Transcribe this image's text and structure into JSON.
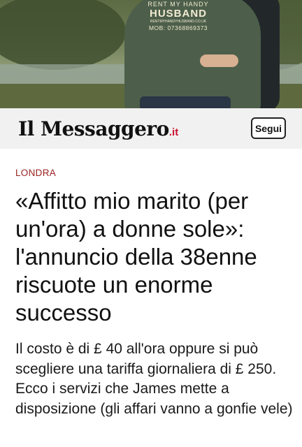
{
  "hero": {
    "shirt_line1": "RENT MY HANDY",
    "shirt_line2": "HUSBAND",
    "shirt_line3": "RENTMYHANDYHUSBAND.CO.UK",
    "shirt_line4": "MOB: 07368869373"
  },
  "masthead": {
    "logo_text": "Il Messaggero",
    "logo_tld": ".it",
    "follow_label": "Segui"
  },
  "article": {
    "category": "LONDRA",
    "headline": "«Affitto mio marito (per un'ora) a donne sole»: l'annuncio della 38enne riscuote un enorme successo",
    "subtitle": "Il costo è di £ 40 all'ora oppure si può scegliere una tariffa giornaliera di £ 250. Ecco i servizi che James mette a disposizione (gli affari vanno a gonfie vele)"
  },
  "colors": {
    "category": "#9a2121",
    "logo_tld": "#c8102e",
    "masthead_bg": "#f1f1f1"
  }
}
